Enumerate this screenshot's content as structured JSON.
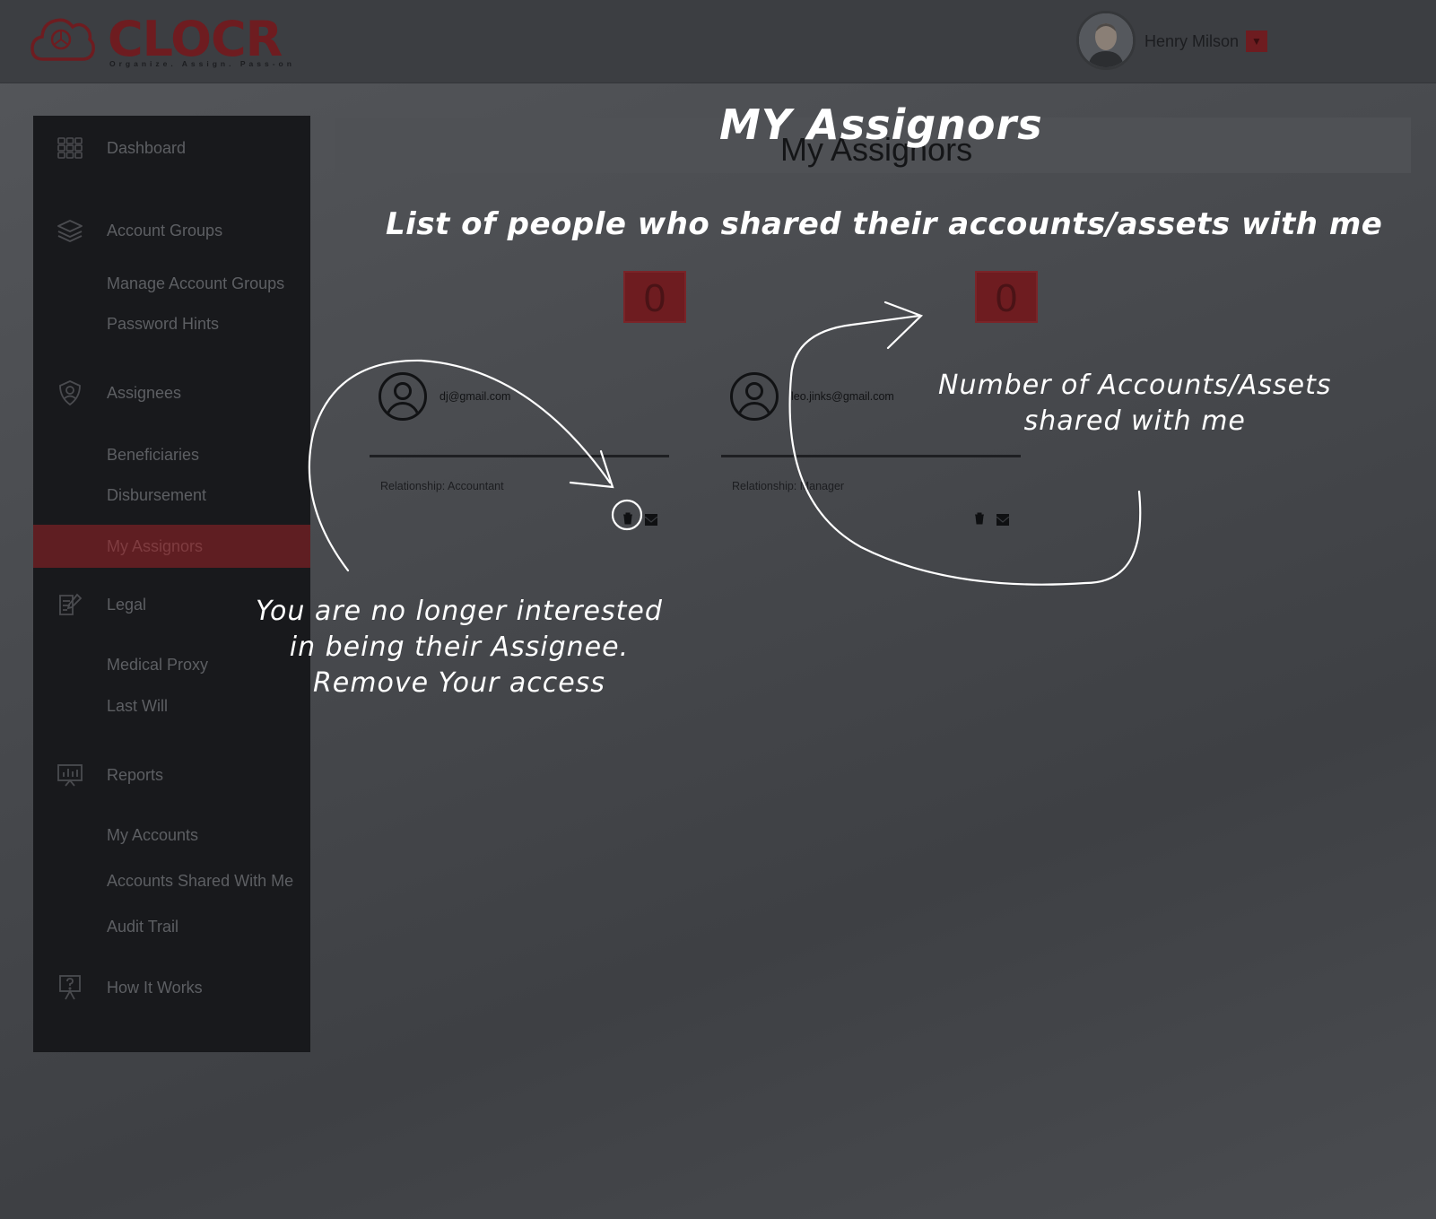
{
  "brand": {
    "name": "CLOCR",
    "tagline": "Organize. Assign. Pass-on",
    "color": "#6e1c20"
  },
  "user": {
    "name": "Henry Milson"
  },
  "sidebar": {
    "items": [
      {
        "label": "Dashboard",
        "icon": "grid-icon"
      },
      {
        "label": "Account Groups",
        "icon": "layers-icon"
      },
      {
        "label": "Manage Account Groups"
      },
      {
        "label": "Password Hints"
      },
      {
        "label": "Assignees",
        "icon": "user-shield-icon"
      },
      {
        "label": "Beneficiaries"
      },
      {
        "label": "Disbursement"
      },
      {
        "label": "My Assignors",
        "active": true
      },
      {
        "label": "Legal",
        "icon": "document-edit-icon"
      },
      {
        "label": "Medical Proxy"
      },
      {
        "label": "Last Will"
      },
      {
        "label": "Reports",
        "icon": "chart-board-icon"
      },
      {
        "label": "My Accounts"
      },
      {
        "label": "Accounts Shared With Me"
      },
      {
        "label": "Audit Trail"
      },
      {
        "label": "How It Works",
        "icon": "question-board-icon"
      }
    ]
  },
  "main": {
    "title": "My Assignors",
    "cards": [
      {
        "count": "0",
        "email": "dj@gmail.com",
        "relationship": "Relationship: Accountant"
      },
      {
        "count": "0",
        "email": "leo.jinks@gmail.com",
        "relationship": "Relationship: Manager"
      }
    ]
  },
  "annotations": {
    "title": "MY Assignors",
    "subtitle": "List of people who shared their accounts/assets with me",
    "count_note_line1": "Number of Accounts/Assets",
    "count_note_line2": "shared with me",
    "remove_note_line1": "You are no longer interested",
    "remove_note_line2": "in being their Assignee.",
    "remove_note_line3": "Remove Your access"
  }
}
